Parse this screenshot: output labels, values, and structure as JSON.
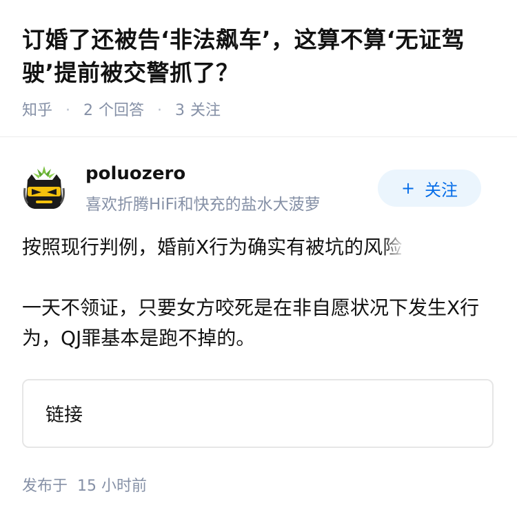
{
  "question": {
    "title": "订婚了还被告‘非法飙车’，这算不算‘无证驾驶’提前被交警抓了？",
    "source": "知乎",
    "answer_count": "2",
    "answer_label": "个回答",
    "follower_count": "3",
    "follower_label": "关注",
    "separator": "·"
  },
  "author": {
    "name": "poluozero",
    "bio": "喜欢折腾HiFi和快充的盐水大菠萝",
    "avatar_icon": "pineapple-cat-avatar-icon",
    "follow_label": "关注",
    "follow_icon": "+"
  },
  "answer": {
    "paragraph1_main": "按照现行判例，婚前X行为确实有被坑的风",
    "paragraph1_faded": "险",
    "paragraph2": "一天不领证，只要女方咬死是在非自愿状况下发生X行为，QJ罪基本是跑不掉的。",
    "link_label": "链接",
    "publish_label": "发布于",
    "publish_time": "15 小时前"
  },
  "colors": {
    "meta_gray": "#8590a6",
    "brand_blue": "#056de8",
    "follow_bg": "#ebf5fd",
    "text": "#121212"
  }
}
